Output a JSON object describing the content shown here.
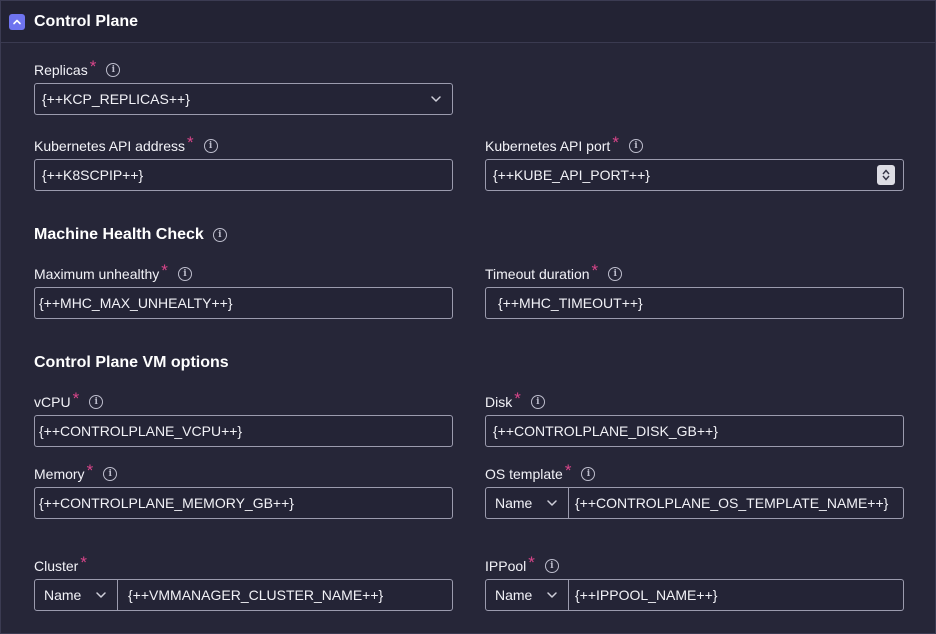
{
  "header": {
    "title": "Control Plane",
    "collapse_icon": "chevron-up-icon"
  },
  "replicas": {
    "label": "Replicas",
    "value": "{++KCP_REPLICAS++}"
  },
  "k8s_address": {
    "label": "Kubernetes API address",
    "value": "{++K8SCPIP++}"
  },
  "k8s_port": {
    "label": "Kubernetes API port",
    "value": "{++KUBE_API_PORT++}"
  },
  "mhc": {
    "title": "Machine Health Check",
    "max_unhealthy": {
      "label": "Maximum unhealthy",
      "value": "{++MHC_MAX_UNHEALTY++}"
    },
    "timeout": {
      "label": "Timeout duration",
      "value": "{++MHC_TIMEOUT++}"
    }
  },
  "vm": {
    "title": "Control Plane VM options",
    "vcpu": {
      "label": "vCPU",
      "value": "{++CONTROLPLANE_VCPU++}"
    },
    "disk": {
      "label": "Disk",
      "value": "{++CONTROLPLANE_DISK_GB++}"
    },
    "memory": {
      "label": "Memory",
      "value": "{++CONTROLPLANE_MEMORY_GB++}"
    },
    "os_template": {
      "label": "OS template",
      "mode": "Name",
      "value": "{++CONTROLPLANE_OS_TEMPLATE_NAME++}"
    },
    "cluster": {
      "label": "Cluster",
      "mode": "Name",
      "value": "{++VMMANAGER_CLUSTER_NAME++}"
    },
    "ippool": {
      "label": "IPPool",
      "mode": "Name",
      "value": "{++IPPOOL_NAME++}"
    }
  },
  "required_marker": "*",
  "info_glyph": "i",
  "colors": {
    "accent": "#6e73ef",
    "required": "#d9458a",
    "background": "#262638"
  }
}
